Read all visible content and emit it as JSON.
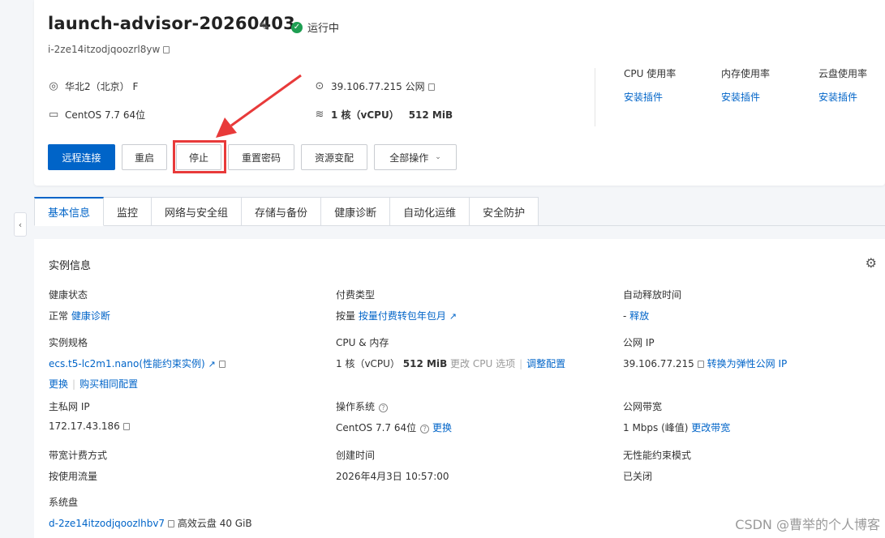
{
  "header": {
    "title": "launch-advisor-20260403",
    "status": "运行中",
    "instance_id": "i-2ze14itzodjqoozrl8yw",
    "region": "华北2（北京） F",
    "public_ip": "39.106.77.215 公网",
    "os": "CentOS 7.7 64位",
    "cpu": "1 核（vCPU）",
    "memory": "512 MiB"
  },
  "usage": [
    {
      "label": "CPU 使用率",
      "link": "安装插件"
    },
    {
      "label": "内存使用率",
      "link": "安装插件"
    },
    {
      "label": "云盘使用率",
      "link": "安装插件"
    }
  ],
  "actions": {
    "remote": "远程连接",
    "restart": "重启",
    "stop": "停止",
    "reset_password": "重置密码",
    "resize": "资源变配",
    "all_ops": "全部操作"
  },
  "tabs": [
    "基本信息",
    "监控",
    "网络与安全组",
    "存储与备份",
    "健康诊断",
    "自动化运维",
    "安全防护"
  ],
  "section_title": "实例信息",
  "fields": {
    "health_k": "健康状态",
    "health_v": "正常",
    "health_link": "健康诊断",
    "billing_k": "付费类型",
    "billing_v": "按量",
    "billing_link": "按量付费转包年包月",
    "autorelease_k": "自动释放时间",
    "autorelease_v": "-",
    "autorelease_link": "释放",
    "spec_k": "实例规格",
    "spec_link": "ecs.t5-lc2m1.nano(性能约束实例)",
    "spec_change": "更换",
    "spec_buy": "购买相同配置",
    "cpumem_k": "CPU & 内存",
    "cpumem_cpu": "1 核（vCPU）",
    "cpumem_mem": "512 MiB",
    "cpumem_muted": "更改 CPU 选项",
    "cpumem_link": "调整配置",
    "pubip_k": "公网 IP",
    "pubip_v": "39.106.77.215",
    "pubip_link": "转换为弹性公网 IP",
    "privip_k": "主私网 IP",
    "privip_v": "172.17.43.186",
    "os_k": "操作系统",
    "os_v": "CentOS 7.7 64位",
    "os_link": "更换",
    "bw_k": "公网带宽",
    "bw_v": "1 Mbps (峰值)",
    "bw_link": "更改带宽",
    "bwbill_k": "带宽计费方式",
    "bwbill_v": "按使用流量",
    "created_k": "创建时间",
    "created_v": "2026年4月3日 10:57:00",
    "unlimited_k": "无性能约束模式",
    "unlimited_v": "已关闭",
    "disk_k": "系统盘",
    "disk_link": "d-2ze14itzodjqoozlhbv7",
    "disk_v": "高效云盘  40 GiB"
  },
  "watermark": "CSDN @曹举的个人博客",
  "colors": {
    "accent": "#0064c8",
    "highlight": "#e83a3a",
    "running": "#1e9e52"
  }
}
